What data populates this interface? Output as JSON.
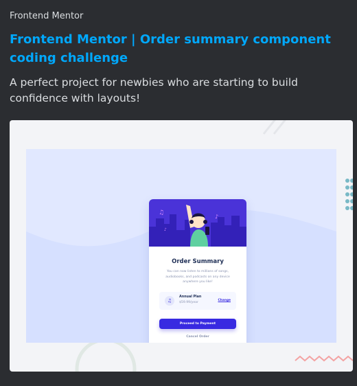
{
  "embed": {
    "provider": "Frontend Mentor",
    "title": "Frontend Mentor | Order summary component coding challenge",
    "description": "A perfect project for newbies who are starting to build confidence with layouts!",
    "accent_color": "#00a8fc",
    "background_color": "#2b2d31"
  },
  "preview": {
    "card": {
      "heading": "Order Summary",
      "text": "You can now listen to millions of songs, audiobooks, and podcasts on any device anywhere you like!",
      "plan_name": "Annual Plan",
      "plan_price": "$59.99/year",
      "change_label": "Change",
      "pay_label": "Proceed to Payment",
      "cancel_label": "Cancel Order",
      "icon": "music-note-icon",
      "primary_color": "#382ae1",
      "frame_color": "#e1e8ff"
    }
  }
}
